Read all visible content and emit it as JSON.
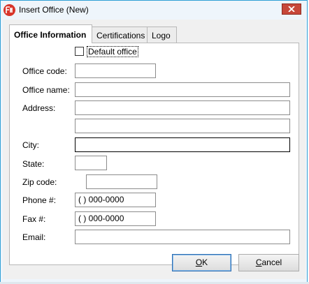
{
  "window": {
    "title": "Insert Office  (New)",
    "icons": {
      "app": "app-logo-icon",
      "close": "close-icon"
    },
    "colors": {
      "frame": "#2f9fd6",
      "close": "#c7483a"
    }
  },
  "tabs": [
    {
      "label": "Office Information",
      "active": true
    },
    {
      "label": "Certifications",
      "active": false
    },
    {
      "label": "Logo",
      "active": false
    }
  ],
  "form": {
    "default_office": {
      "label": "Default office",
      "checked": false
    },
    "office_code": {
      "label": "Office code:",
      "value": ""
    },
    "office_name": {
      "label": "Office name:",
      "value": ""
    },
    "address": {
      "label": "Address:",
      "line1": "",
      "line2": ""
    },
    "city": {
      "label": "City:",
      "value": ""
    },
    "state": {
      "label": "State:",
      "value": ""
    },
    "zip": {
      "label": "Zip code:",
      "value": ""
    },
    "phone": {
      "label": "Phone #:",
      "value": "(   ) 000-0000"
    },
    "fax": {
      "label": "Fax #:",
      "value": "(   ) 000-0000"
    },
    "email": {
      "label": "Email:",
      "value": ""
    }
  },
  "buttons": {
    "ok": {
      "accel": "O",
      "rest": "K"
    },
    "cancel": {
      "accel": "C",
      "rest": "ancel"
    }
  }
}
